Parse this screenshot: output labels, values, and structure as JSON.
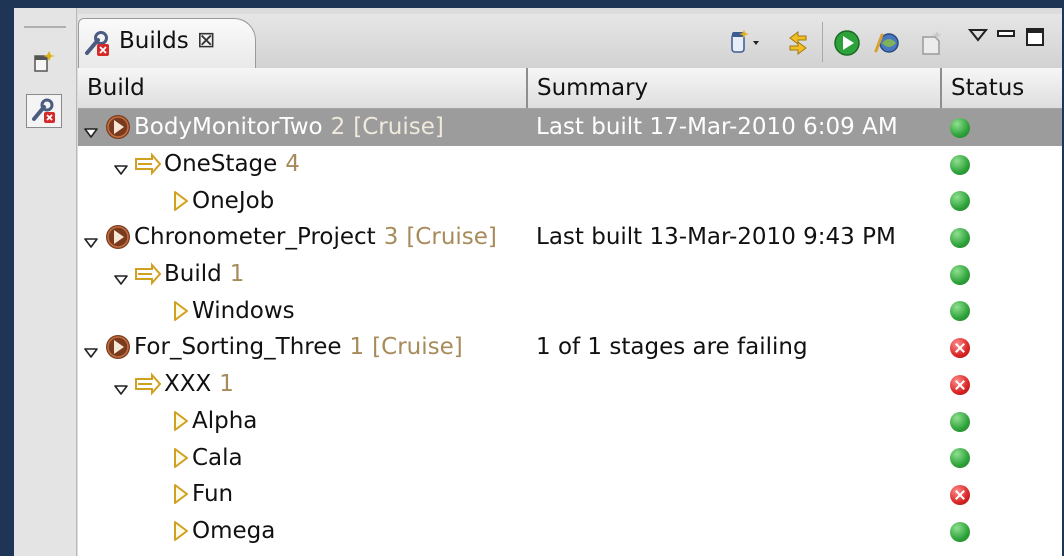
{
  "view": {
    "tab_label": "Builds",
    "tab_close": "⊠"
  },
  "columns": {
    "build": "Build",
    "summary": "Summary",
    "status": "Status"
  },
  "rows": [
    {
      "level": 0,
      "kind": "project",
      "name": "BodyMonitorTwo",
      "count": "2",
      "tag": "[Cruise]",
      "summary": "Last built 17-Mar-2010 6:09 AM",
      "status": "ok",
      "selected": true
    },
    {
      "level": 1,
      "kind": "stage",
      "name": "OneStage",
      "count": "4",
      "tag": "",
      "summary": "",
      "status": "ok"
    },
    {
      "level": 2,
      "kind": "job",
      "name": "OneJob",
      "count": "",
      "tag": "",
      "summary": "",
      "status": "ok"
    },
    {
      "level": 0,
      "kind": "project",
      "name": "Chronometer_Project",
      "count": "3",
      "tag": "[Cruise]",
      "summary": "Last built 13-Mar-2010 9:43 PM",
      "status": "ok"
    },
    {
      "level": 1,
      "kind": "stage",
      "name": "Build",
      "count": "1",
      "tag": "",
      "summary": "",
      "status": "ok"
    },
    {
      "level": 2,
      "kind": "job",
      "name": "Windows",
      "count": "",
      "tag": "",
      "summary": "",
      "status": "ok"
    },
    {
      "level": 0,
      "kind": "project",
      "name": "For_Sorting_Three",
      "count": "1",
      "tag": "[Cruise]",
      "summary": "1 of 1 stages are failing",
      "status": "fail"
    },
    {
      "level": 1,
      "kind": "stage",
      "name": "XXX",
      "count": "1",
      "tag": "",
      "summary": "",
      "status": "fail"
    },
    {
      "level": 2,
      "kind": "job",
      "name": "Alpha",
      "count": "",
      "tag": "",
      "summary": "",
      "status": "ok"
    },
    {
      "level": 2,
      "kind": "job",
      "name": "Cala",
      "count": "",
      "tag": "",
      "summary": "",
      "status": "ok"
    },
    {
      "level": 2,
      "kind": "job",
      "name": "Fun",
      "count": "",
      "tag": "",
      "summary": "",
      "status": "fail"
    },
    {
      "level": 2,
      "kind": "job",
      "name": "Omega",
      "count": "",
      "tag": "",
      "summary": "",
      "status": "ok"
    }
  ],
  "colors": {
    "background": "#1f3556",
    "selected_row": "#9c9c9c",
    "status_ok": "#2ea23a",
    "status_fail": "#d92626",
    "count_text": "#a78b5a"
  }
}
